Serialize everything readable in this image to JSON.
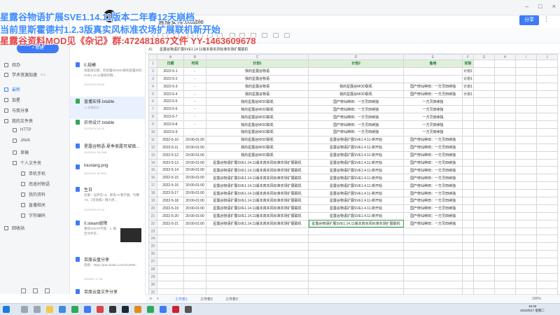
{
  "window": {
    "doc_title": "直播安排.txtable",
    "share_label": "分享",
    "controls": [
      "–",
      "□",
      "×"
    ]
  },
  "overlay": {
    "line1": "星露谷物语扩展SVE1.14.11版本二年春12天崩档",
    "line2": "当前里斯霍德村1.2.3版真实风标准农场扩展联机新开始",
    "line3": "星露谷资料MOD见《杂记》群:472481867文件 YY-1463609678"
  },
  "sidebar": {
    "new_label": "+ 新建",
    "items": [
      {
        "label": "待办",
        "icon": "todo-icon"
      },
      {
        "label": "学术资源加速",
        "icon": "rocket-icon",
        "badge": "873"
      },
      {
        "label": "最新",
        "icon": "clock-icon",
        "active": true
      },
      {
        "label": "加星",
        "icon": "star-icon"
      },
      {
        "label": "与我分享",
        "icon": "share-icon"
      },
      {
        "label": "我的文件夹",
        "icon": "folder-icon"
      }
    ],
    "folders": [
      "HTTP",
      "JAVA",
      "草稿",
      "个人文件夹"
    ],
    "subfolders": [
      "单机手机",
      "南遥村物语",
      "我的资料",
      "直播相关",
      "字符编码"
    ],
    "trash_label": "回收站"
  },
  "files": [
    {
      "name": "0.规模",
      "desc": "别胆演记家：利星露谷MOD联机星露谷的SVE1.14.11版版的数...",
      "meta": "2022/5/19 09:08",
      "icon": "doc-icon",
      "color": "#3d7bf7"
    },
    {
      "name": "直播安排.txtable",
      "desc": "",
      "meta": "16 直播相关",
      "icon": "sheet-icon",
      "color": "#2fa85a",
      "selected": true
    },
    {
      "name": "农场设计.txtable",
      "desc": "",
      "meta": "2022/5/26 10:28",
      "icon": "sheet-icon",
      "color": "#2fa85a"
    },
    {
      "name": "星露谷物语-夏季美露可城镇...",
      "desc": "",
      "meta": "2022/5/11 16.1MB",
      "icon": "doc-icon",
      "color": "#3d7bf7"
    },
    {
      "name": "touxiang.png",
      "desc": "",
      "meta": "2022/5/11 50.3KB",
      "icon": "image-icon",
      "color": "#3d7bf7"
    },
    {
      "name": "生日",
      "desc": "杜蒙：仙界花+9、果语+9 梗子酿、竹鞭+9、《花语集》狮爪兽...",
      "meta": "2022/5/10 07:54",
      "icon": "doc-icon",
      "color": "#3d7bf7"
    },
    {
      "name": "0.steam故障",
      "desc": "重装SMAPI不能：2. 确定文件夹...",
      "meta": "",
      "icon": "doc-icon",
      "color": "#3d7bf7"
    },
    {
      "name": "百度云盘分享",
      "desc": "链接：https://pan.baidu.com/s/1eRM...",
      "meta": "2022/5/7 17:28",
      "icon": "doc-icon",
      "color": "#3d7bf7"
    },
    {
      "name": "百度云盘文件分享",
      "desc": "",
      "meta": "",
      "icon": "doc-icon",
      "color": "#3d7bf7"
    }
  ],
  "sheet": {
    "cell_ref": "A1",
    "formula": "星露谷物语扩展SVE1.14.11版本真实风标准农场扩展联机",
    "col_letters": [
      "",
      "A",
      "B",
      "C",
      "D",
      "E",
      "F",
      "G",
      "H",
      "I",
      "J"
    ],
    "headers": [
      "日期",
      "时间",
      "计划1",
      "计划2",
      "备用",
      "实际"
    ],
    "rows": [
      {
        "n": "2",
        "date": "2022-5-1",
        "time": "-",
        "p1": "我的星露谷物语",
        "p2": "",
        "alt": "",
        "actual": "计划1"
      },
      {
        "n": "3",
        "date": "2022-5-2",
        "time": "-",
        "p1": "我的星露谷物语",
        "p2": "",
        "alt": "",
        "actual": "计划1"
      },
      {
        "n": "4",
        "date": "2022-5-3",
        "time": "-",
        "p1": "我的星露谷物语",
        "p2": "我的星露谷MOD联机",
        "alt": "国产修仙种田：一方灵田续独",
        "actual": "计划1"
      },
      {
        "n": "5",
        "date": "2022-5-4",
        "time": "-",
        "p1": "我的星露谷物语",
        "p2": "我的星露谷MOD联机",
        "alt": "国产修仙种田：一方灵田续独",
        "actual": "计划1"
      },
      {
        "n": "6",
        "date": "2022-5-5",
        "time": "-",
        "p1": "我的星露谷MOD联机",
        "p2": "国产修仙种田：一方灵田续独",
        "alt": "一方灵田续独",
        "actual": ""
      },
      {
        "n": "7",
        "date": "2022-5-6",
        "time": "-",
        "p1": "我的星露谷MOD联机",
        "p2": "国产修仙种田：一方灵田续独",
        "alt": "一方灵田续独",
        "actual": ""
      },
      {
        "n": "8",
        "date": "2022-5-7",
        "time": "-",
        "p1": "我的星露谷MOD联机",
        "p2": "国产修仙种田：一方灵田续独",
        "alt": "一方灵田续独",
        "actual": ""
      },
      {
        "n": "9",
        "date": "2022-5-8",
        "time": "-",
        "p1": "我的星露谷MOD联机",
        "p2": "国产修仙种田：一方灵田续独",
        "alt": "一方灵田续独",
        "actual": ""
      },
      {
        "n": "10",
        "date": "2022-5-9",
        "time": "-",
        "p1": "我的星露谷MOD联机",
        "p2": "国产修仙种田：一方灵田续独",
        "alt": "一方灵田续独",
        "actual": ""
      },
      {
        "n": "11",
        "date": "2022-5-10",
        "time": "20:00-01:00",
        "p1": "我的星露谷MOD联机",
        "p2": "星露谷物语扩展SVE1.4.11-新开始",
        "alt": "国产修仙种田：一方灵田续独",
        "actual": ""
      },
      {
        "n": "12",
        "date": "2022-5-11",
        "time": "20:00-01:00",
        "p1": "我的星露谷MOD联机",
        "p2": "星露谷物语扩展SVE1.4.11-新开始",
        "alt": "国产修仙种田：一方灵田续独",
        "actual": ""
      },
      {
        "n": "13",
        "date": "2022-5-12",
        "time": "20:00-01:00",
        "p1": "我的星露谷MOD联机",
        "p2": "星露谷物语扩展SVE1.4.11-新开始",
        "alt": "国产修仙种田：一方灵田续独",
        "actual": ""
      },
      {
        "n": "14",
        "date": "2022-5-13",
        "time": "20:00-01:00",
        "p1": "星露谷物语扩展SVE1.14.11版本真实风标准农场扩展联机",
        "p2": "星露谷物语扩展SVE1.4.11-新开始",
        "alt": "国产修仙种田：一方灵田续独",
        "actual": ""
      },
      {
        "n": "15",
        "date": "2022-5-14",
        "time": "20:00-01:00",
        "p1": "星露谷物语扩展SVE1.14.11版本真实风标准农场扩展联机",
        "p2": "星露谷物语扩展SVE1.4.11-新开始",
        "alt": "国产修仙种田：一方灵田续独",
        "actual": ""
      },
      {
        "n": "16",
        "date": "2022-5-15",
        "time": "20:00-01:00",
        "p1": "星露谷物语扩展SVE1.14.11版本真实风标准农场扩展联机",
        "p2": "星露谷物语扩展SVE1.4.11-新开始",
        "alt": "国产修仙种田：一方灵田续独",
        "actual": ""
      },
      {
        "n": "17",
        "date": "2022-5-16",
        "time": "20:00-01:00",
        "p1": "星露谷物语扩展SVE1.14.11版本真实风标准农场扩展联机",
        "p2": "星露谷物语扩展SVE1.4.11-新开始",
        "alt": "国产修仙种田：一方灵田续独",
        "actual": ""
      },
      {
        "n": "18",
        "date": "2022-5-17",
        "time": "20:00-01:00",
        "p1": "星露谷物语扩展SVE1.14.11版本真实风标准农场扩展联机",
        "p2": "星露谷物语扩展SVE1.4.11-新开始",
        "alt": "国产修仙种田：一方灵田续独",
        "actual": ""
      },
      {
        "n": "19",
        "date": "2022-5-18",
        "time": "20:00-01:00",
        "p1": "星露谷物语扩展SVE1.14.11版本真实风标准农场扩展联机",
        "p2": "星露谷物语扩展SVE1.4.11-新开始",
        "alt": "国产修仙种田：一方灵田续独",
        "actual": ""
      },
      {
        "n": "20",
        "date": "2022-5-19",
        "time": "20:00-01:00",
        "p1": "星露谷物语扩展SVE1.14.11版本真实风标准农场扩展联机",
        "p2": "星露谷物语扩展SVE1.4.11-新开始",
        "alt": "国产修仙种田：一方灵田续独",
        "actual": ""
      },
      {
        "n": "21",
        "date": "2022-5-20",
        "time": "20:00-01:00",
        "p1": "星露谷物语扩展SVE1.14.11版本真实风标准农场扩展联机",
        "p2": "星露谷物语扩展SVE1.4.11-新开始",
        "alt": "国产修仙种田：一方灵田续独",
        "actual": ""
      },
      {
        "n": "22",
        "date": "2022-5-21",
        "time": "20:00-01:00",
        "p1": "星露谷物语扩展SVE1.14.11版本真实风标准农场扩展联机",
        "p2": "星露谷物语扩展SVE1.14.11版本真实风标准农场扩展联机",
        "alt": "国产修仙种田：一方灵田续独",
        "actual": ""
      }
    ],
    "empty_row_numbers": [
      "23",
      "24",
      "25",
      "26",
      "27",
      "28",
      "29",
      "30",
      "31",
      "32"
    ],
    "tabs": [
      "工作表1",
      "工作表2",
      "工作表3"
    ],
    "zoom": "100%"
  },
  "clock": {
    "time": "16:40",
    "date": "2022/5/17 星期二"
  }
}
